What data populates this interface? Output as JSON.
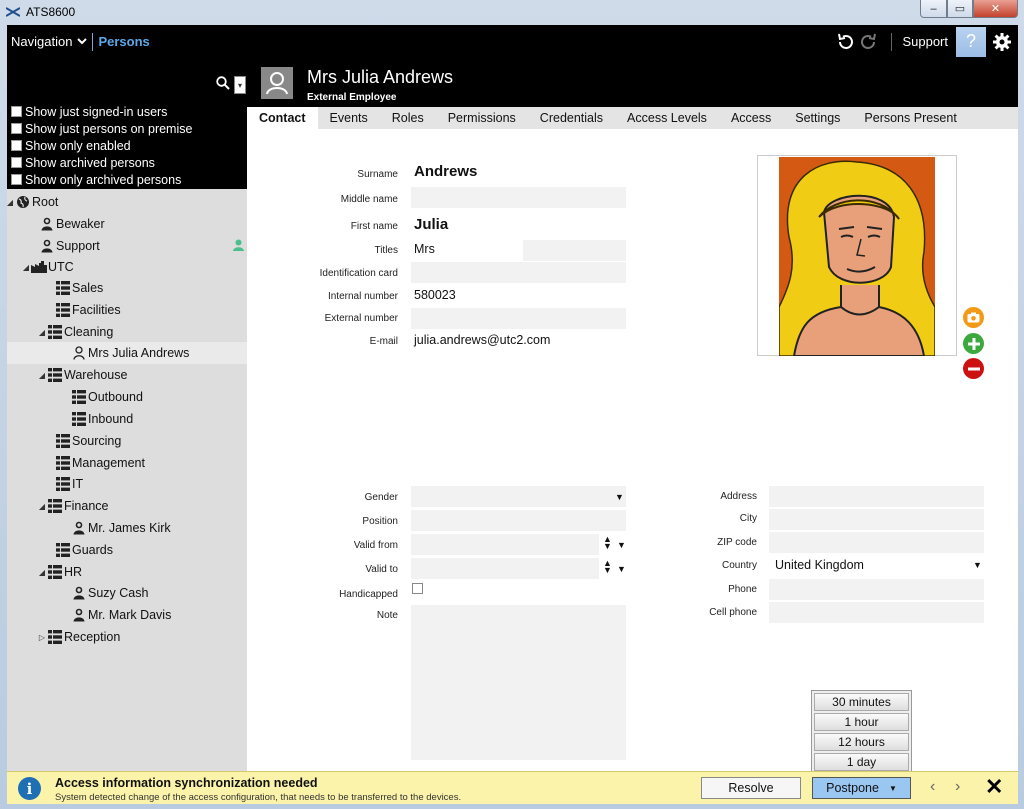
{
  "window": {
    "title": "ATS8600",
    "min": "–",
    "max": "▭",
    "close": "✕"
  },
  "topbar": {
    "navigation_label": "Navigation",
    "breadcrumb": "Persons",
    "support_label": "Support",
    "avatar_glyph": "?"
  },
  "filters": [
    "Show just signed-in users",
    "Show just persons on premise",
    "Show only enabled",
    "Show archived persons",
    "Show only archived persons"
  ],
  "tree": [
    {
      "label": "Root",
      "icon": "globe-icon",
      "expander": "◢",
      "present": false,
      "selected": false
    },
    {
      "label": "Bewaker",
      "icon": "person-icon",
      "expander": "",
      "present": false,
      "selected": false
    },
    {
      "label": "Support",
      "icon": "person-icon",
      "expander": "",
      "present": true,
      "selected": false
    },
    {
      "label": "UTC",
      "icon": "factory-icon",
      "expander": "◢",
      "present": false,
      "selected": false
    },
    {
      "label": "Sales",
      "icon": "department-icon",
      "expander": "",
      "present": false,
      "selected": false
    },
    {
      "label": "Facilities",
      "icon": "department-icon",
      "expander": "",
      "present": false,
      "selected": false
    },
    {
      "label": "Cleaning",
      "icon": "department-icon",
      "expander": "◢",
      "present": false,
      "selected": false
    },
    {
      "label": "Mrs Julia Andrews",
      "icon": "person-outline-icon",
      "expander": "",
      "present": false,
      "selected": true
    },
    {
      "label": "Warehouse",
      "icon": "department-icon",
      "expander": "◢",
      "present": false,
      "selected": false
    },
    {
      "label": "Outbound",
      "icon": "department-icon",
      "expander": "",
      "present": false,
      "selected": false
    },
    {
      "label": "Inbound",
      "icon": "department-icon",
      "expander": "",
      "present": false,
      "selected": false
    },
    {
      "label": "Sourcing",
      "icon": "department-icon",
      "expander": "",
      "present": false,
      "selected": false
    },
    {
      "label": "Management",
      "icon": "department-icon",
      "expander": "",
      "present": false,
      "selected": false
    },
    {
      "label": "IT",
      "icon": "department-icon",
      "expander": "",
      "present": false,
      "selected": false
    },
    {
      "label": "Finance",
      "icon": "department-icon",
      "expander": "◢",
      "present": false,
      "selected": false
    },
    {
      "label": "Mr. James Kirk",
      "icon": "person-icon",
      "expander": "",
      "present": false,
      "selected": false
    },
    {
      "label": "Guards",
      "icon": "department-icon",
      "expander": "",
      "present": false,
      "selected": false
    },
    {
      "label": "HR",
      "icon": "department-icon",
      "expander": "◢",
      "present": false,
      "selected": false
    },
    {
      "label": "Suzy Cash",
      "icon": "person-icon",
      "expander": "",
      "present": false,
      "selected": false
    },
    {
      "label": "Mr. Mark Davis",
      "icon": "person-icon",
      "expander": "",
      "present": false,
      "selected": false
    },
    {
      "label": "Reception",
      "icon": "department-icon",
      "expander": "▷",
      "present": false,
      "selected": false
    }
  ],
  "person": {
    "display_name": "Mrs Julia Andrews",
    "type": "External Employee"
  },
  "tabs": [
    "Contact",
    "Events",
    "Roles",
    "Permissions",
    "Credentials",
    "Access Levels",
    "Access",
    "Settings",
    "Persons Present"
  ],
  "contact": {
    "labels": {
      "surname": "Surname",
      "middle_name": "Middle name",
      "first_name": "First name",
      "titles": "Titles",
      "identification_card": "Identification card",
      "internal_number": "Internal number",
      "external_number": "External number",
      "email": "E-mail",
      "gender": "Gender",
      "position": "Position",
      "valid_from": "Valid from",
      "valid_to": "Valid to",
      "handicapped": "Handicapped",
      "note": "Note",
      "address": "Address",
      "city": "City",
      "zip": "ZIP code",
      "country": "Country",
      "phone": "Phone",
      "cell_phone": "Cell phone"
    },
    "values": {
      "surname": "Andrews",
      "middle_name": "",
      "first_name": "Julia",
      "titles": "Mrs",
      "identification_card": "",
      "internal_number": "580023",
      "external_number": "",
      "email": "julia.andrews@utc2.com",
      "gender": "",
      "position": "",
      "valid_from": "",
      "valid_to": "",
      "address": "",
      "city": "",
      "zip": "",
      "country": "United Kingdom",
      "phone": "",
      "cell_phone": ""
    }
  },
  "notification": {
    "title": "Access information synchronization needed",
    "description": "System detected change of the access configuration, that needs to be transferred to the devices.",
    "resolve_label": "Resolve",
    "postpone_label": "Postpone",
    "postpone_options": [
      "30 minutes",
      "1 hour",
      "12 hours",
      "1 day"
    ],
    "close": "✕"
  },
  "colors": {
    "accent": "#5da9ea",
    "notify_bg": "#fbf3a9",
    "postpone_bg": "#9ac6f2",
    "present": "#4cbd8c"
  }
}
